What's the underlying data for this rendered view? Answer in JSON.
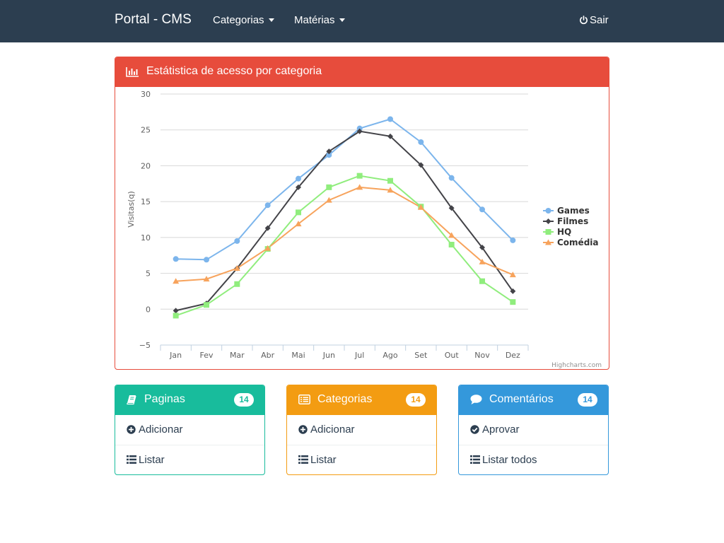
{
  "navbar": {
    "brand": "Portal - CMS",
    "categorias_label": "Categorias",
    "materias_label": "Matérias",
    "sair_label": "Sair"
  },
  "chart_panel": {
    "title": "Estátistica de acesso por categoria",
    "credits": "Highcharts.com"
  },
  "chart_data": {
    "type": "line",
    "title": "",
    "xlabel": "",
    "ylabel": "Visitas(q)",
    "ylim": [
      -5,
      30
    ],
    "yticks": [
      -5,
      0,
      5,
      10,
      15,
      20,
      25,
      30
    ],
    "categories": [
      "Jan",
      "Fev",
      "Mar",
      "Abr",
      "Mai",
      "Jun",
      "Jul",
      "Ago",
      "Set",
      "Out",
      "Nov",
      "Dez"
    ],
    "legend_position": "right",
    "grid": true,
    "series": [
      {
        "name": "Games",
        "color": "#7cb5ec",
        "marker": "circle",
        "values": [
          7.0,
          6.9,
          9.5,
          14.5,
          18.2,
          21.5,
          25.2,
          26.5,
          23.3,
          18.3,
          13.9,
          9.6
        ]
      },
      {
        "name": "Filmes",
        "color": "#434348",
        "marker": "diamond",
        "values": [
          -0.2,
          0.8,
          5.7,
          11.3,
          17.0,
          22.0,
          24.8,
          24.1,
          20.1,
          14.1,
          8.6,
          2.5
        ]
      },
      {
        "name": "HQ",
        "color": "#90ed7d",
        "marker": "square",
        "values": [
          -0.9,
          0.6,
          3.5,
          8.4,
          13.5,
          17.0,
          18.6,
          17.9,
          14.3,
          9.0,
          3.9,
          1.0
        ]
      },
      {
        "name": "Comédia",
        "color": "#f7a35c",
        "marker": "triangle",
        "values": [
          3.9,
          4.2,
          5.7,
          8.5,
          11.9,
          15.2,
          17.0,
          16.6,
          14.2,
          10.3,
          6.6,
          4.8
        ]
      }
    ]
  },
  "panels": [
    {
      "title": "Paginas",
      "badge": "14",
      "color": "#18bc9c",
      "icon": "book-icon",
      "items": [
        {
          "label": "Adicionar",
          "icon": "plus-circle-icon"
        },
        {
          "label": "Listar",
          "icon": "list-icon"
        }
      ]
    },
    {
      "title": "Categorias",
      "badge": "14",
      "color": "#f39c12",
      "icon": "list-alt-icon",
      "items": [
        {
          "label": "Adicionar",
          "icon": "plus-circle-icon"
        },
        {
          "label": "Listar",
          "icon": "list-icon"
        }
      ]
    },
    {
      "title": "Comentários",
      "badge": "14",
      "color": "#3498db",
      "icon": "comment-icon",
      "items": [
        {
          "label": "Aprovar",
          "icon": "check-circle-icon"
        },
        {
          "label": "Listar todos",
          "icon": "list-icon"
        }
      ]
    }
  ]
}
